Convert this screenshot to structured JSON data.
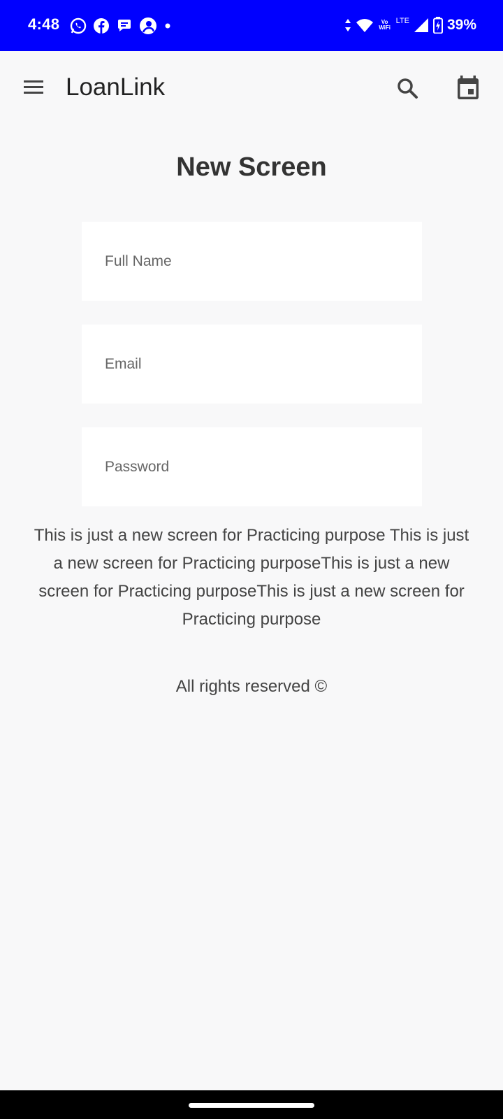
{
  "status_bar": {
    "time": "4:48",
    "volte_top": "Vo",
    "volte_bottom": "WiFi",
    "network": "LTE",
    "battery": "39%",
    "icons_left": [
      "whatsapp-icon",
      "facebook-icon",
      "chat-icon",
      "avatar-icon",
      "dot-icon"
    ],
    "icons_right": [
      "data-arrows-icon",
      "wifi-icon",
      "volte-icon",
      "signal-icon",
      "battery-charging-icon"
    ],
    "background": "#0000ff"
  },
  "app_bar": {
    "title": "LoanLink",
    "menu_icon": "menu-icon",
    "search_icon": "search-icon",
    "calendar_icon": "calendar-icon"
  },
  "main": {
    "title": "New Screen",
    "fields": {
      "full_name": {
        "placeholder": "Full Name",
        "value": ""
      },
      "email": {
        "placeholder": "Email",
        "value": ""
      },
      "password": {
        "placeholder": "Password",
        "value": ""
      }
    },
    "description": "This is just a new screen for Practicing purpose This is just a new screen for Practicing purposeThis is just a new screen for Practicing purposeThis is just a new screen for Practicing purpose",
    "footer": "All rights reserved ©"
  }
}
